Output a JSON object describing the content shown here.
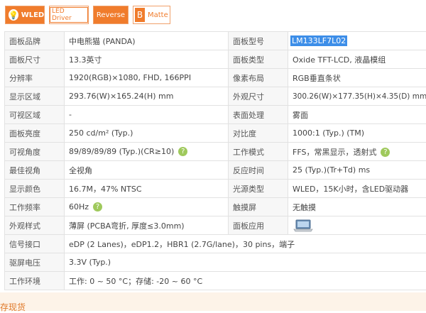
{
  "badges": [
    {
      "label": "WLED",
      "icon": "lightbulb-icon"
    },
    {
      "label": "LED Driver"
    },
    {
      "label": "Reverse"
    },
    {
      "label": "Matte",
      "icon_glyph": "B"
    }
  ],
  "rows": [
    {
      "k1": "面板品牌",
      "v1": "中电熊猫 (PANDA)",
      "k2": "面板型号",
      "v2": "LM133LF7L02"
    },
    {
      "k1": "面板尺寸",
      "v1": "13.3英寸",
      "k2": "面板类型",
      "v2": "Oxide TFT-LCD, 液晶模组"
    },
    {
      "k1": "分辨率",
      "v1": "1920(RGB)×1080, FHD, 166PPI",
      "k2": "像素布局",
      "v2": "RGB垂直条状"
    },
    {
      "k1": "显示区域",
      "v1": "293.76(W)×165.24(H) mm",
      "k2": "外观尺寸",
      "v2": "300.26(W)×177.35(H)×4.35(D) mm"
    },
    {
      "k1": "可视区域",
      "v1": "-",
      "k2": "表面处理",
      "v2": "雾面"
    },
    {
      "k1": "面板亮度",
      "v1": "250 cd/m² (Typ.)",
      "k2": "对比度",
      "v2": "1000:1 (Typ.) (TM)"
    },
    {
      "k1": "可视角度",
      "v1": "89/89/89/89 (Typ.)(CR≥10)",
      "k2": "工作模式",
      "v2": "FFS，常黑显示，透射式"
    },
    {
      "k1": "最佳视角",
      "v1": "全视角",
      "k2": "反应时间",
      "v2": "25 (Typ.)(Tr+Td) ms"
    },
    {
      "k1": "显示颜色",
      "v1": "16.7M，47% NTSC",
      "k2": "光源类型",
      "v2": "WLED，15K小时，含LED驱动器"
    },
    {
      "k1": "工作频率",
      "v1": "60Hz",
      "k2": "触摸屏",
      "v2": "无触摸"
    },
    {
      "k1": "外观样式",
      "v1": "薄屏 (PCBA弯折, 厚度≤3.0mm)",
      "k2": "面板应用",
      "v2": ""
    },
    {
      "k1": "信号接口",
      "v1": "eDP (2 Lanes)，eDP1.2，HBR1 (2.7G/lane)，30 pins，端子"
    },
    {
      "k1": "驱屏电压",
      "v1": "3.3V (Typ.)"
    },
    {
      "k1": "工作环境",
      "v1": "工作: 0 ~ 50 °C；存储: -20 ~ 60 °C"
    }
  ],
  "help_glyph": "?",
  "bottom_text": "存现货",
  "colors": {
    "accent": "#f07c2c",
    "selection": "#3d8ee8",
    "help": "#9fc95c"
  }
}
